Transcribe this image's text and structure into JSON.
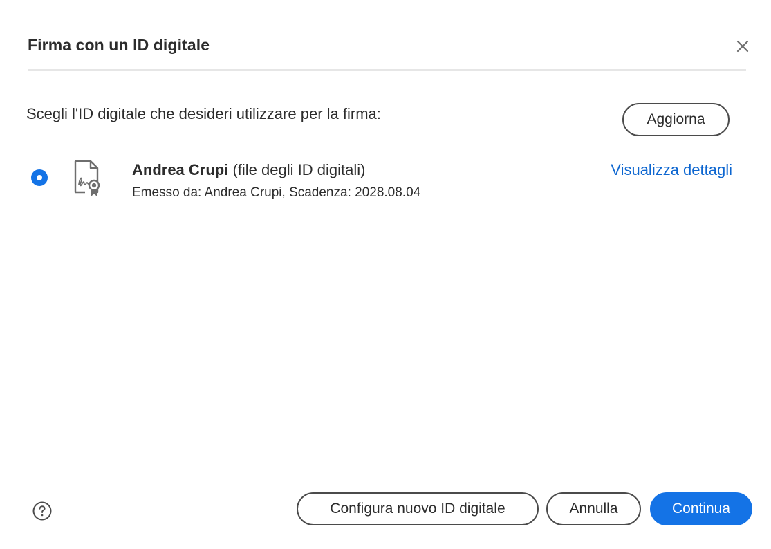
{
  "dialog": {
    "title": "Firma con un ID digitale",
    "instruction": "Scegli l'ID digitale che desideri utilizzare per la firma:",
    "refresh_label": "Aggiorna"
  },
  "digital_id": {
    "selected": true,
    "name": "Andrea Crupi",
    "type": " (file degli ID digitali)",
    "issued_info": "Emesso da: Andrea Crupi, Scadenza: 2028.08.04",
    "details_link": "Visualizza dettagli",
    "icon": "certificate-icon"
  },
  "footer": {
    "configure_label": "Configura nuovo ID digitale",
    "cancel_label": "Annulla",
    "continue_label": "Continua",
    "help_icon": "help-icon"
  },
  "colors": {
    "accent": "#1473e6",
    "link": "#0d66d0",
    "text": "#2c2c2c"
  }
}
